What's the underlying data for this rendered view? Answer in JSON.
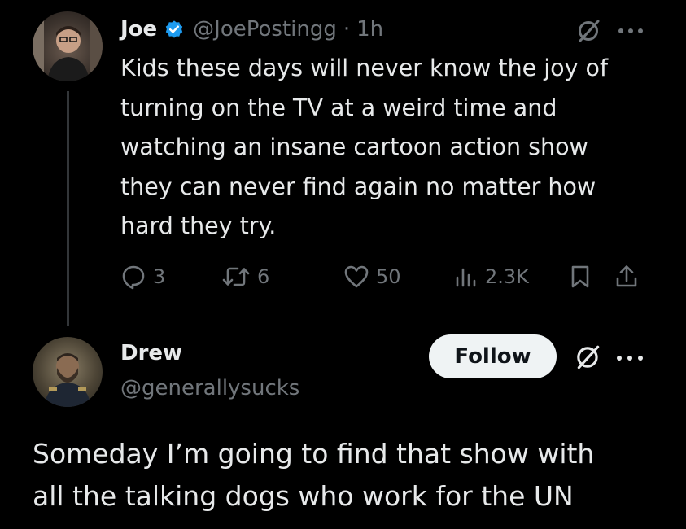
{
  "tweet": {
    "author_name": "Joe",
    "handle": "@JoePostingg",
    "separator": "·",
    "time": "1h",
    "text": "Kids these days will never know the joy of\nturning on the TV at a weird time and\nwatching an insane cartoon action show\nthey can never find again no matter how\nhard they try.",
    "replies": "3",
    "retweets": "6",
    "likes": "50",
    "views": "2.3K"
  },
  "reply": {
    "author_name": "Drew",
    "handle": "@generallysucks",
    "follow_label": "Follow",
    "text": "Someday I’m going to find that show with\nall the talking dogs who work for the UN"
  },
  "colors": {
    "background": "#000000",
    "text_primary": "#e7e9ea",
    "text_secondary": "#71767b",
    "verified_blue": "#1d9bf0",
    "follow_bg": "#eff3f4",
    "thread_line": "#333639"
  },
  "icons": {
    "verified": "verified-badge-icon",
    "grok": "grok-icon",
    "more": "more-options-icon",
    "reply": "reply-icon",
    "retweet": "retweet-icon",
    "like": "heart-icon",
    "views": "views-chart-icon",
    "bookmark": "bookmark-icon",
    "share": "share-icon"
  }
}
